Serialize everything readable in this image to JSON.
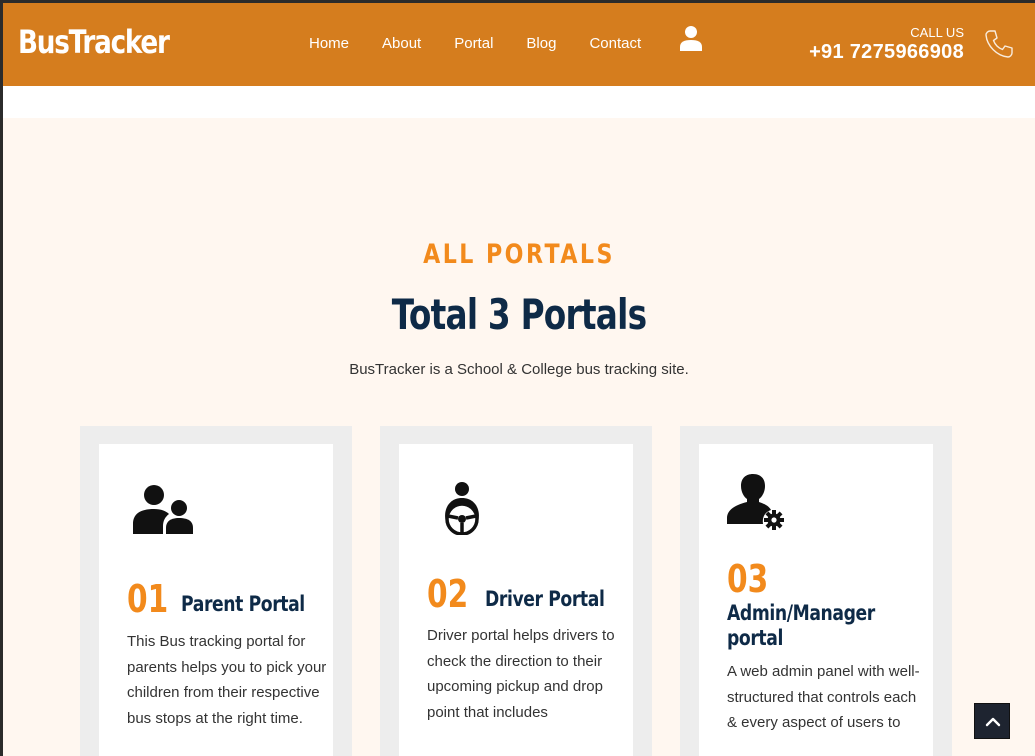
{
  "header": {
    "logo": "BusTracker",
    "nav": [
      "Home",
      "About",
      "Portal",
      "Blog",
      "Contact"
    ],
    "call_label": "CALL US",
    "call_number": "+91 7275966908"
  },
  "section": {
    "eyebrow": "ALL PORTALS",
    "title": "Total 3 Portals",
    "subtitle": "BusTracker is a School & College bus tracking site."
  },
  "cards": [
    {
      "number": "01",
      "title": "Parent Portal",
      "description": "This Bus tracking portal for parents helps you to pick your children from their respective bus stops at the right time.",
      "icon": "parents-icon"
    },
    {
      "number": "02",
      "title": "Driver Portal",
      "description": "Driver portal helps drivers to check the direction to their upcoming pickup and drop point that includes",
      "icon": "driver-steering-icon"
    },
    {
      "number": "03",
      "title_line1": "Admin/Manager",
      "title_line2": "portal",
      "description": "A web admin panel with well-structured that controls each & every aspect of users to",
      "icon": "admin-gear-icon"
    }
  ],
  "colors": {
    "header_bg": "#d57d1e",
    "accent": "#f28a1c",
    "heading": "#0e2a47",
    "section_bg": "#fff7f0"
  }
}
